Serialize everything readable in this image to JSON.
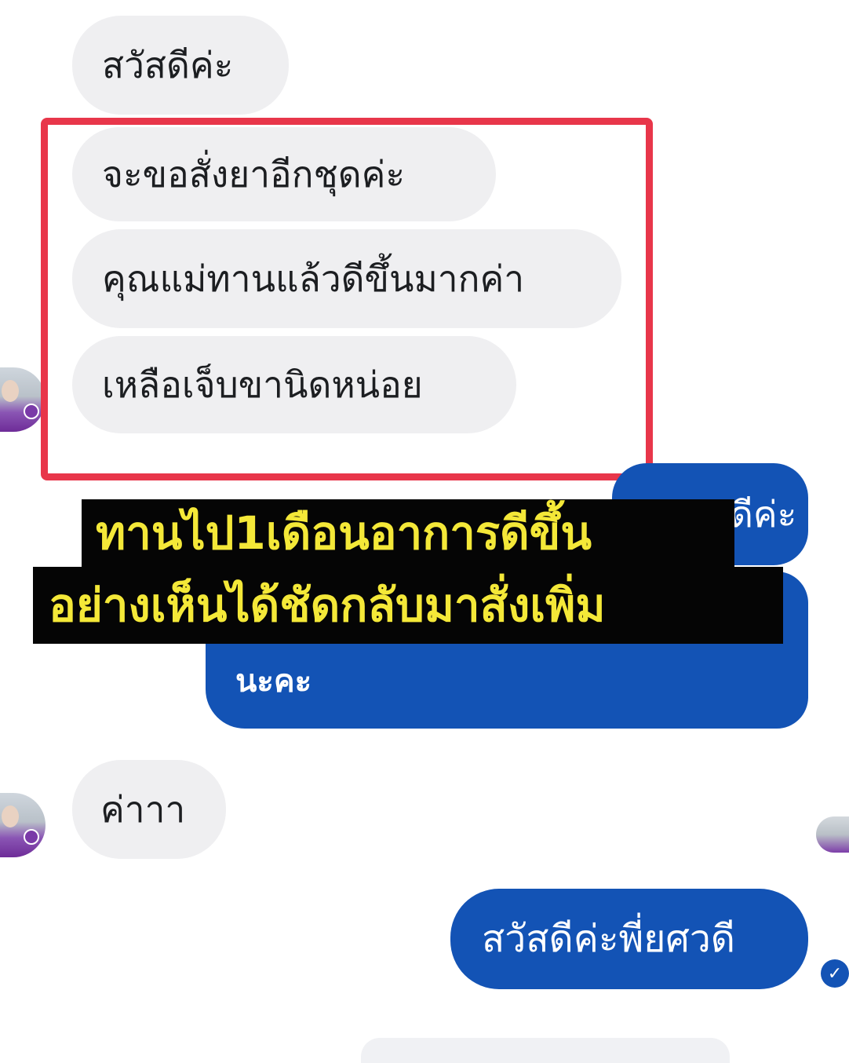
{
  "chat": {
    "incoming": [
      "สวัสดีค่ะ",
      "จะขอสั่งยาอีกชุดค่ะ",
      "คุณแม่ทานแล้วดีขึ้นมากค่า",
      "เหลือเจ็บขานิดหน่อย",
      "ค่าาา"
    ],
    "outgoing": [
      "ดีค่ะ",
      "นะคะ",
      "สวัสดีค่ะพี่ยศวดี"
    ]
  },
  "caption": {
    "line1": "ทานไป1เดือนอาการดีขึ้น",
    "line2": "อย่างเห็นได้ชัดกลับมาสั่งเพิ่ม"
  },
  "status": {
    "check_glyph": "✓"
  },
  "colors": {
    "highlight_border": "#e8364a",
    "outgoing_bubble": "#1353b5",
    "incoming_bubble": "#efeff1",
    "caption_text": "#f4e838",
    "caption_bg": "#050505"
  },
  "icons": {
    "sender_avatar": "avatar-icon",
    "read_receipt": "check-circle-icon"
  }
}
